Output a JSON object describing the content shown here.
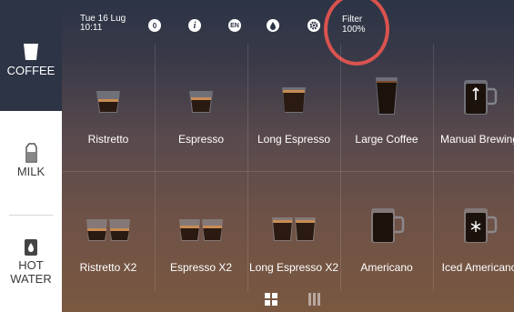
{
  "sidebar": {
    "items": [
      {
        "label": "COFFEE",
        "icon": "coffee-cup-icon",
        "active": true
      },
      {
        "label": "MILK",
        "icon": "milk-carton-icon",
        "active": false
      },
      {
        "label": "HOT\nWATER",
        "icon": "water-drop-icon",
        "active": false
      }
    ]
  },
  "status": {
    "date": "Tue 16 Lug",
    "time": "10:11",
    "counter": "0",
    "info": "i",
    "language": "EN",
    "filter_label": "Filter",
    "filter_value": "100%"
  },
  "beverages": [
    {
      "label": "Ristretto",
      "icon": "single-glass-cup-icon"
    },
    {
      "label": "Espresso",
      "icon": "single-glass-cup-icon"
    },
    {
      "label": "Long Espresso",
      "icon": "single-glass-cup-icon"
    },
    {
      "label": "Large Coffee",
      "icon": "tall-glass-icon"
    },
    {
      "label": "Manual Brewing",
      "icon": "mug-manual-icon"
    },
    {
      "label": "Ristretto X2",
      "icon": "double-glass-cup-icon"
    },
    {
      "label": "Espresso X2",
      "icon": "double-glass-cup-icon"
    },
    {
      "label": "Long Espresso X2",
      "icon": "double-glass-cup-icon"
    },
    {
      "label": "Americano",
      "icon": "mug-icon"
    },
    {
      "label": "Iced Americano",
      "icon": "mug-ice-icon"
    }
  ],
  "colors": {
    "sidebar_active": "#2d3445",
    "highlight_ring": "#d9534f"
  }
}
